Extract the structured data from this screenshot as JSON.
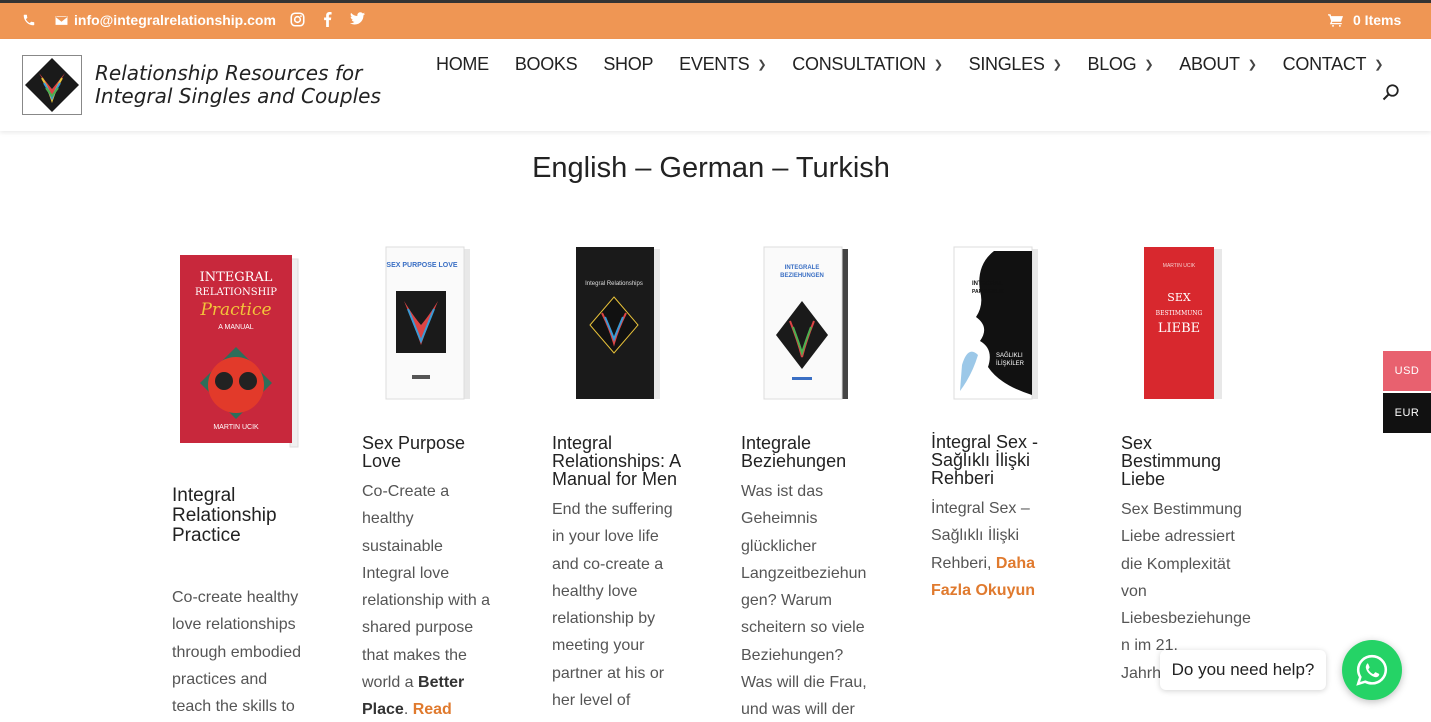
{
  "topbar": {
    "email": "info@integralrelationship.com",
    "cart_label": "0 Items",
    "icons": [
      "phone-icon",
      "envelope-icon",
      "instagram-icon",
      "facebook-icon",
      "twitter-icon",
      "cart-icon"
    ]
  },
  "header": {
    "tagline_line1": "Relationship Resources for",
    "tagline_line2": "Integral Singles and Couples",
    "nav": [
      {
        "label": "HOME",
        "dropdown": false
      },
      {
        "label": "BOOKS",
        "dropdown": false
      },
      {
        "label": "SHOP",
        "dropdown": false
      },
      {
        "label": "EVENTS",
        "dropdown": true
      },
      {
        "label": "CONSULTATION",
        "dropdown": true
      },
      {
        "label": "SINGLES",
        "dropdown": true
      },
      {
        "label": "BLOG",
        "dropdown": true
      },
      {
        "label": "ABOUT",
        "dropdown": true
      },
      {
        "label": "CONTACT",
        "dropdown": true
      }
    ]
  },
  "main": {
    "section_title": "English – German – Turkish",
    "books": [
      {
        "title_lines": [
          "Integral",
          "Relationship",
          "Practice"
        ],
        "desc_lines": [
          "Co-create healthy",
          "love relationships",
          "through embodied",
          "practices and",
          "teach the skills to"
        ],
        "cover": {
          "bg": "#c8283c",
          "text_lines": [
            "INTEGRAL",
            "RELATIONSHIP",
            "Practice",
            "A MANUAL",
            "MARTIN UCIK"
          ]
        }
      },
      {
        "title_lines": [
          "Sex Purpose",
          "Love"
        ],
        "desc_lines": [
          "Co-Create a",
          "healthy",
          "sustainable",
          "Integral love",
          "relationship with a",
          "shared purpose",
          "that makes the"
        ],
        "desc_tail": {
          "plain": "world a ",
          "bold": "Better",
          "line2_bold": "Place",
          "line2_plain": ". ",
          "link": "Read"
        },
        "cover": {
          "bg": "#ffffff",
          "text_lines": [
            "SEX PURPOSE LOVE"
          ]
        }
      },
      {
        "title_lines": [
          "Integral",
          "Relationships: A",
          "Manual for Men"
        ],
        "desc_lines": [
          "End the suffering",
          "in your love life",
          "and co-create a",
          "healthy love",
          "relationship by",
          "meeting your",
          "partner at his or",
          "her level of"
        ],
        "cover": {
          "bg": "#1a1a1a",
          "text_lines": [
            "Integral Relationships"
          ]
        }
      },
      {
        "title_lines": [
          "Integrale",
          "Beziehungen"
        ],
        "desc_lines": [
          "Was ist das",
          "Geheimnis",
          "glücklicher",
          "Langzeitbeziehun",
          "gen? Warum",
          "scheitern so viele",
          "Beziehungen?",
          "Was will die Frau,",
          "und was will der"
        ],
        "cover": {
          "bg": "#ffffff",
          "text_lines": [
            "INTEGRALE",
            "BEZIEHUNGEN"
          ]
        }
      },
      {
        "title_lines": [
          "İntegral Sex -",
          "Sağlıklı İlişki",
          "Rehberi"
        ],
        "desc_lines": [
          "İntegral Sex –",
          "Sağlıklı İlişki"
        ],
        "desc_link_prefix": "Rehberi, ",
        "desc_link_line1": "Daha",
        "desc_link_line2": "Fazla Okuyun",
        "cover": {
          "bg": "#ffffff",
          "text_lines": [
            "INTEGRAL",
            "PARTNERLIK",
            "SAĞLIKLI",
            "İLİŞKİLER"
          ]
        }
      },
      {
        "title_lines": [
          "Sex",
          "Bestimmung",
          "Liebe"
        ],
        "desc_lines": [
          "Sex Bestimmung",
          "Liebe adressiert",
          "die Komplexität",
          "von",
          "Liebesbeziehunge",
          "n im 21.",
          "Jahrh"
        ],
        "cover": {
          "bg": "#d8282e",
          "text_lines": [
            "MARTIN UCIK",
            "SEX",
            "BESTIMMUNG",
            "LIEBE"
          ]
        }
      }
    ]
  },
  "currency": {
    "usd": "USD",
    "eur": "EUR"
  },
  "chat": {
    "help_text": "Do you need help?"
  },
  "colors": {
    "topbar": "#ef9654",
    "link": "#e07a2e",
    "usd_bg": "#e8616f",
    "eur_bg": "#111111",
    "whatsapp": "#25d366"
  }
}
